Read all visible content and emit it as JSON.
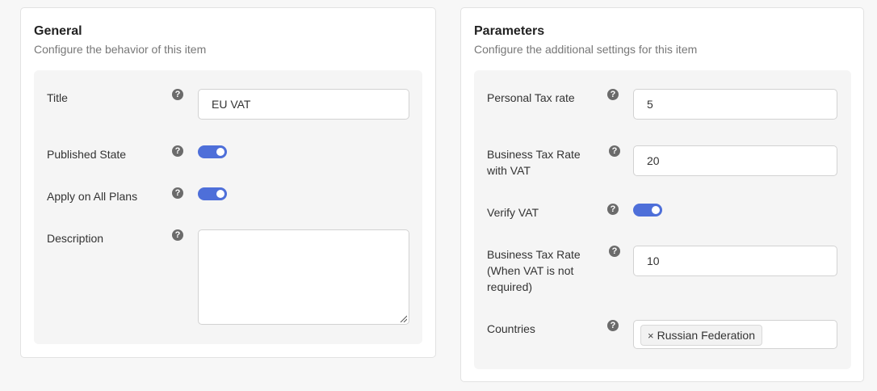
{
  "general": {
    "title": "General",
    "subtitle": "Configure the behavior of this item",
    "fields": {
      "title_label": "Title",
      "title_value": "EU VAT",
      "published_label": "Published State",
      "published_on": true,
      "apply_all_label": "Apply on All Plans",
      "apply_all_on": true,
      "description_label": "Description",
      "description_value": ""
    }
  },
  "parameters": {
    "title": "Parameters",
    "subtitle": "Configure the additional settings for this item",
    "fields": {
      "personal_rate_label": "Personal Tax rate",
      "personal_rate_value": "5",
      "business_rate_label_1": "Business Tax Rate",
      "business_rate_label_2": "with VAT",
      "business_rate_value": "20",
      "verify_vat_label": "Verify VAT",
      "verify_vat_on": true,
      "business_no_vat_label_1": "Business Tax Rate",
      "business_no_vat_label_2": "(When VAT is not",
      "business_no_vat_label_3": "required)",
      "business_no_vat_value": "10",
      "countries_label": "Countries",
      "countries_tags": [
        {
          "remove": "×",
          "label": "Russian Federation"
        }
      ]
    }
  },
  "help_icon_glyph": "?",
  "colors": {
    "toggle_on": "#4e6fd9",
    "help_icon": "#6b6b6b"
  }
}
